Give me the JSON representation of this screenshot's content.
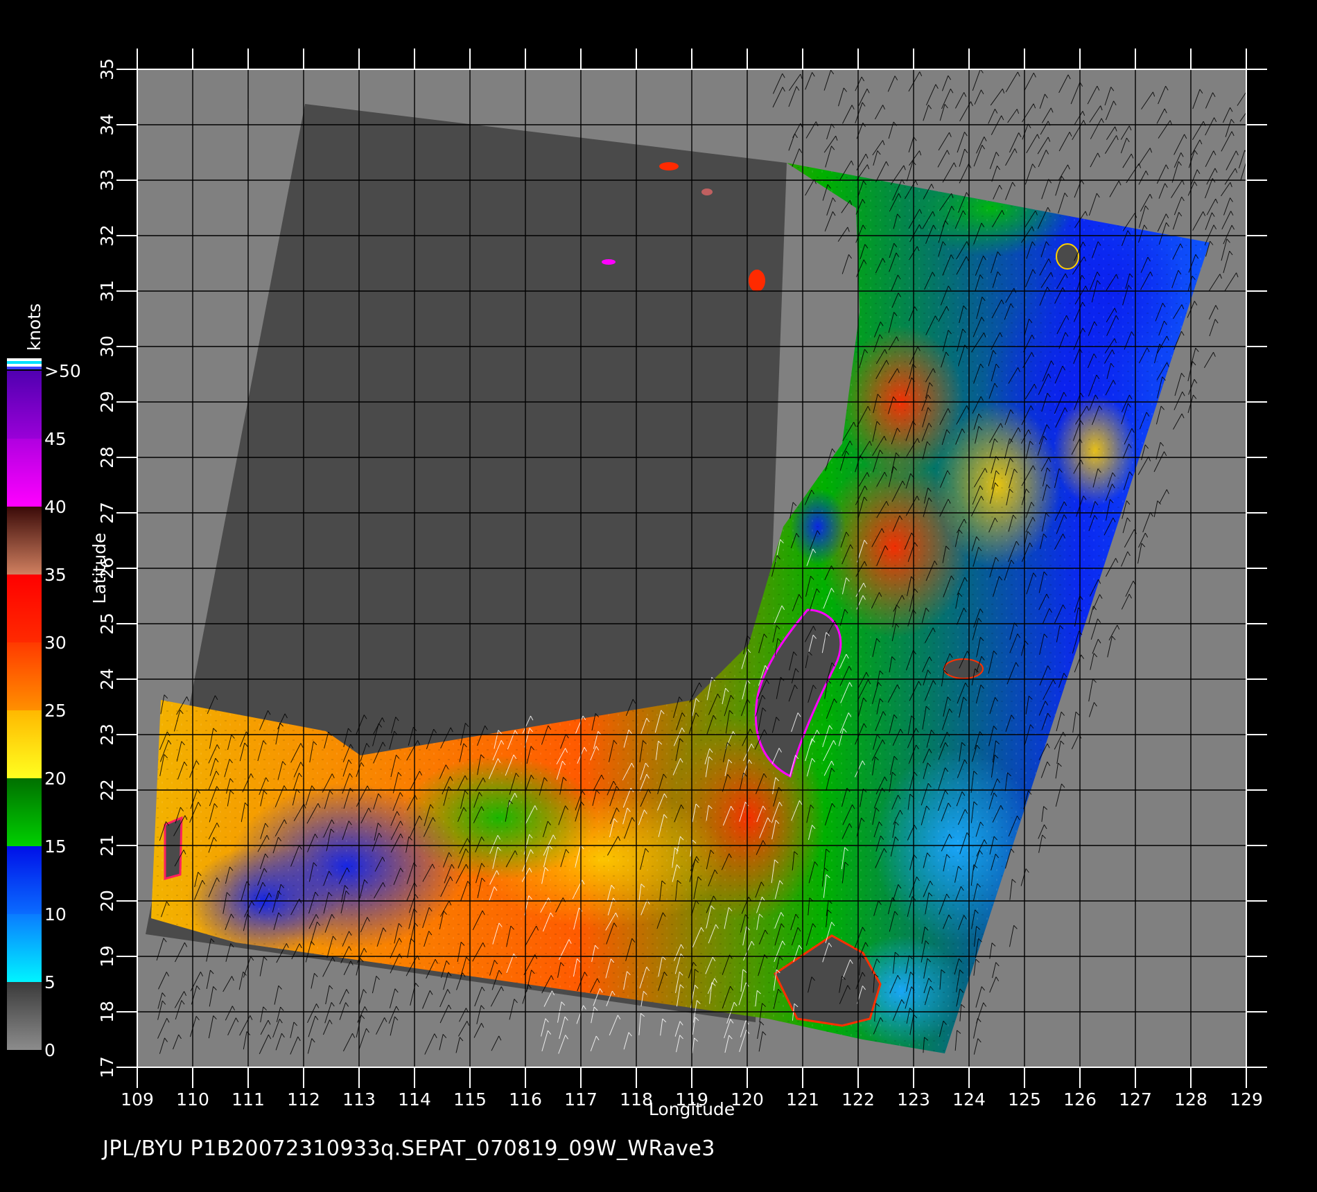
{
  "map": {
    "axis": {
      "x_label": "Longitude",
      "y_label": "Latitude",
      "lon_range": [
        109,
        129
      ],
      "lat_range": [
        17,
        35
      ],
      "lon_ticks": [
        "109",
        "110",
        "111",
        "112",
        "113",
        "114",
        "115",
        "116",
        "117",
        "118",
        "119",
        "120",
        "121",
        "122",
        "123",
        "124",
        "125",
        "126",
        "127",
        "128",
        "129"
      ],
      "lat_ticks": [
        "17",
        "18",
        "19",
        "20",
        "21",
        "22",
        "23",
        "24",
        "25",
        "26",
        "27",
        "28",
        "29",
        "30",
        "31",
        "32",
        "33",
        "34",
        "35"
      ]
    },
    "colorbar": {
      "unit": "knots",
      "labels": [
        "0",
        "5",
        "10",
        "15",
        "20",
        "25",
        "30",
        "35",
        "40",
        "45",
        ">50"
      ],
      "bands": [
        {
          "from": 0,
          "to": 5,
          "colors": [
            "#8c8c8c",
            "#3a3a3a"
          ]
        },
        {
          "from": 5,
          "to": 10,
          "colors": [
            "#00f4ff",
            "#0a7cff"
          ]
        },
        {
          "from": 10,
          "to": 15,
          "colors": [
            "#0a6cff",
            "#0010e8"
          ]
        },
        {
          "from": 15,
          "to": 20,
          "colors": [
            "#00d000",
            "#007000"
          ]
        },
        {
          "from": 20,
          "to": 25,
          "colors": [
            "#ffff20",
            "#ffb800"
          ]
        },
        {
          "from": 25,
          "to": 30,
          "colors": [
            "#ff9000",
            "#ff3a00"
          ]
        },
        {
          "from": 30,
          "to": 35,
          "colors": [
            "#ff2a00",
            "#ff0000"
          ]
        },
        {
          "from": 35,
          "to": 40,
          "colors": [
            "#d08060",
            "#3a0a08"
          ]
        },
        {
          "from": 40,
          "to": 45,
          "colors": [
            "#ff00ff",
            "#b000e0"
          ]
        },
        {
          "from": 45,
          "to": 50,
          "colors": [
            "#9a00d8",
            "#5000b0"
          ]
        }
      ]
    },
    "colors": {
      "background": "#000000",
      "outside_swath": "#808080",
      "land": "#4a4a4a",
      "grid": "#000000"
    }
  },
  "footer": {
    "text": "JPL/BYU  P1B20072310933q.SEPAT_070819_09W_WRave3"
  }
}
